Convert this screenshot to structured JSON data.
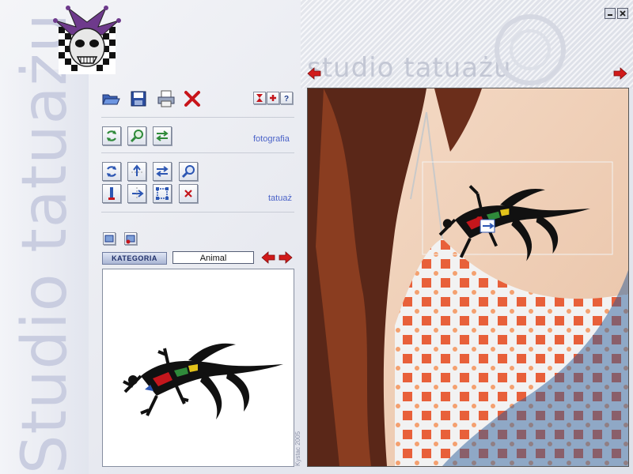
{
  "app": {
    "title_vertical": "Studio tatuażu",
    "title_header": "studio tatuażu",
    "credit": "Kystac 2005"
  },
  "window_controls": {
    "minimize": "minimize",
    "close": "close"
  },
  "toolbar": {
    "file_icons": [
      "folder-open-icon",
      "save-icon",
      "print-icon",
      "close-icon"
    ],
    "help_icons": [
      "hourglass-icon",
      "plus-icon",
      "help-icon"
    ]
  },
  "sections": {
    "photo_label": "fotografia",
    "tattoo_label": "tatuaż"
  },
  "category": {
    "button_label": "KATEGORIA",
    "value": "Animal"
  },
  "colors": {
    "accent_blue": "#4b63c8",
    "arrow_red": "#d11a1a",
    "icon_green": "#2f8a3a"
  }
}
